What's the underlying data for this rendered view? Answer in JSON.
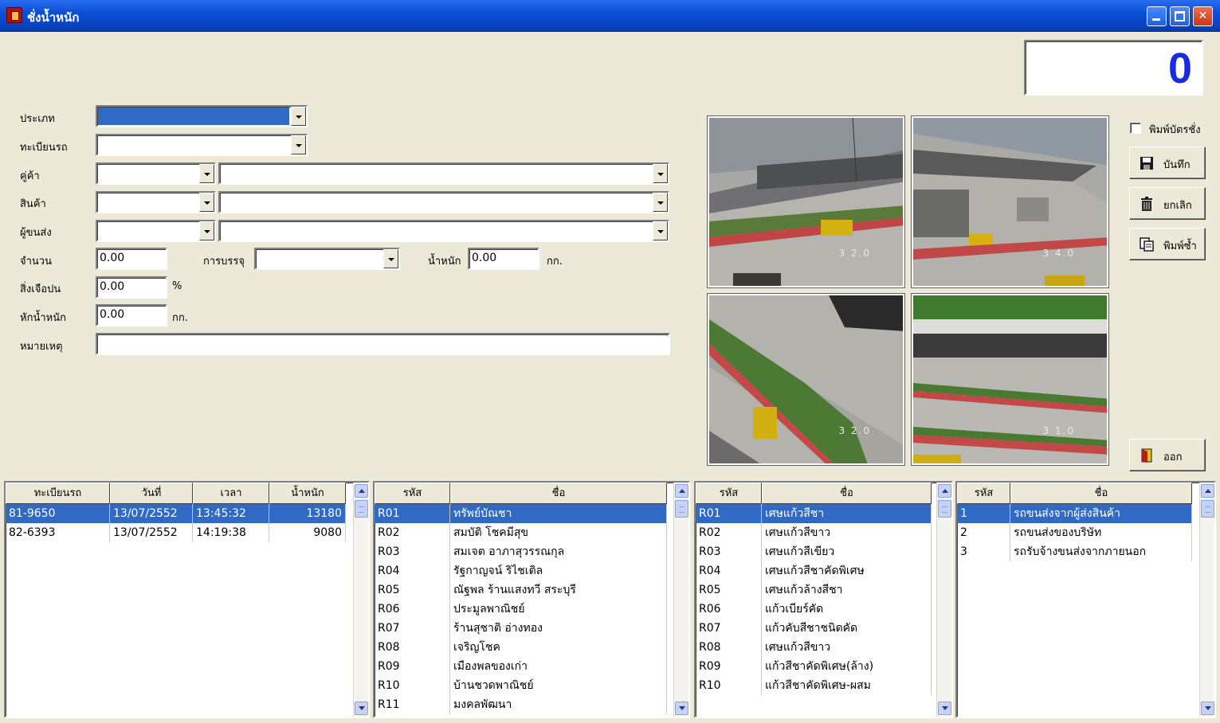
{
  "window": {
    "title": "ชั่งน้ำหนัก"
  },
  "counter": {
    "value": "0"
  },
  "form": {
    "type_label": "ประเภท",
    "plate_label": "ทะเบียนรถ",
    "partner_label": "คู่ค้า",
    "product_label": "สินค้า",
    "carrier_label": "ผู้ขนส่ง",
    "qty_label": "จำนวน",
    "qty_value": "0.00",
    "package_label": "การบรรจุ",
    "weight_label": "น้ำหนัก",
    "weight_value": "0.00",
    "weight_unit": "กก.",
    "impurity_label": "สิ่งเจือปน",
    "impurity_value": "0.00",
    "impurity_unit": "%",
    "deduct_label": "หักน้ำหนัก",
    "deduct_value": "0.00",
    "deduct_unit": "กก.",
    "note_label": "หมายเหตุ"
  },
  "actions": {
    "print_ticket_label": "พิมพ์บัตรชั่ง",
    "save_label": "บันทึก",
    "cancel_label": "ยกเลิก",
    "reprint_label": "พิมพ์ซ้ำ",
    "exit_label": "ออก"
  },
  "cameras": [
    {
      "label": "3 2.0"
    },
    {
      "label": "3 4.0"
    },
    {
      "label": "3 2.0"
    },
    {
      "label": "3 1.0"
    }
  ],
  "weigh_table": {
    "headers": [
      "ทะเบียนรถ",
      "วันที่",
      "เวลา",
      "น้ำหนัก"
    ],
    "rows": [
      [
        "81-9650",
        "13/07/2552",
        "13:45:32",
        "13180"
      ],
      [
        "82-6393",
        "13/07/2552",
        "14:19:38",
        "9080"
      ]
    ]
  },
  "partner_table": {
    "headers": [
      "รหัส",
      "ชื่อ"
    ],
    "rows": [
      [
        "R01",
        "ทรัพย์บัณชา"
      ],
      [
        "R02",
        "สมบัติ โชคมีสุข"
      ],
      [
        "R03",
        "สมเจต อาภาสุวรรณกุล"
      ],
      [
        "R04",
        "รัฐกาญจน์ ริไชเติล"
      ],
      [
        "R05",
        "ณัฐพล ร้านแสงทวี สระบุรี"
      ],
      [
        "R06",
        "ประมูลพาณิชย์"
      ],
      [
        "R07",
        "ร้านสุชาติ อ่างทอง"
      ],
      [
        "R08",
        "เจริญโชค"
      ],
      [
        "R09",
        "เมืองพลของเก่า"
      ],
      [
        "R10",
        "บ้านชวดพาณิชย์"
      ],
      [
        "R11",
        "มงคลพัฒนา"
      ]
    ]
  },
  "product_table": {
    "headers": [
      "รหัส",
      "ชื่อ"
    ],
    "rows": [
      [
        "R01",
        "เศษแก้วสีชา"
      ],
      [
        "R02",
        "เศษแก้วสีขาว"
      ],
      [
        "R03",
        "เศษแก้วสีเขียว"
      ],
      [
        "R04",
        "เศษแก้วสีชาคัดพิเศษ"
      ],
      [
        "R05",
        "เศษแก้วล้างสีชา"
      ],
      [
        "R06",
        "แก้วเบียร์คัด"
      ],
      [
        "R07",
        "แก้วคับสีชาชนิดคัด"
      ],
      [
        "R08",
        "เศษแก้วสีขาว"
      ],
      [
        "R09",
        "แก้วสีชาคัดพิเศษ(ล้าง)"
      ],
      [
        "R10",
        "แก้วสีชาคัดพิเศษ-ผสม"
      ]
    ]
  },
  "carrier_table": {
    "headers": [
      "รหัส",
      "ชื่อ"
    ],
    "rows": [
      [
        "1",
        "รถขนส่งจากผู้ส่งสินค้า"
      ],
      [
        "2",
        "รถขนส่งของบริษัท"
      ],
      [
        "3",
        "รถรับจ้างขนส่งจากภายนอก"
      ]
    ]
  }
}
